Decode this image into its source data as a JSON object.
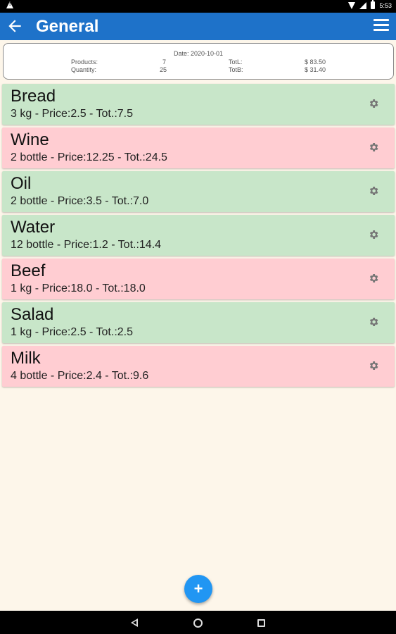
{
  "status_bar": {
    "time": "5:53",
    "icons": [
      "warning-icon",
      "wifi-icon",
      "signal-icon",
      "battery-icon"
    ]
  },
  "app_bar": {
    "title": "General",
    "back_icon": "arrow-back-icon",
    "menu_icon": "menu-icon"
  },
  "summary": {
    "date": "Date: 2020-10-01",
    "products_label": "Products:",
    "products_value": "7",
    "quantity_label": "Quantity:",
    "quantity_value": "25",
    "totl_label": "TotL:",
    "totl_value": "$ 83.50",
    "totb_label": "TotB:",
    "totb_value": "$ 31.40"
  },
  "items": [
    {
      "name": "Bread",
      "details": "3 kg - Price:2.5 - Tot.:7.5",
      "color": "green"
    },
    {
      "name": "Wine",
      "details": "2 bottle - Price:12.25 - Tot.:24.5",
      "color": "pink"
    },
    {
      "name": "Oil",
      "details": "2 bottle - Price:3.5 - Tot.:7.0",
      "color": "green"
    },
    {
      "name": "Water",
      "details": "12 bottle - Price:1.2 - Tot.:14.4",
      "color": "green"
    },
    {
      "name": "Beef",
      "details": "1 kg - Price:18.0 - Tot.:18.0",
      "color": "pink"
    },
    {
      "name": "Salad",
      "details": "1 kg - Price:2.5 - Tot.:2.5",
      "color": "green"
    },
    {
      "name": "Milk",
      "details": "4 bottle - Price:2.4 - Tot.:9.6",
      "color": "pink"
    }
  ],
  "fab": {
    "label": "+"
  },
  "colors": {
    "app_bar": "#1e72c9",
    "background": "#fdf6ea",
    "green_item": "#c8e6c9",
    "pink_item": "#ffcdd2",
    "fab": "#2196f3"
  }
}
